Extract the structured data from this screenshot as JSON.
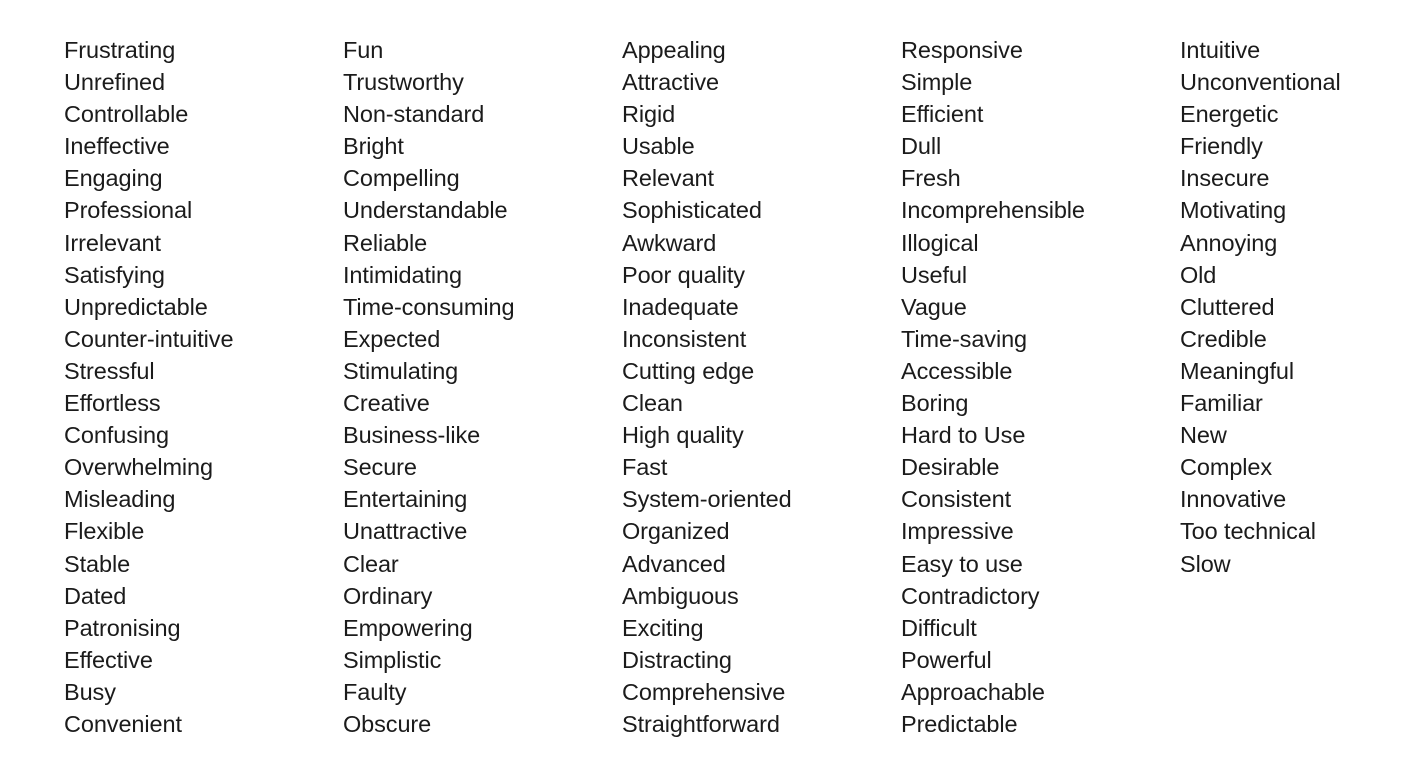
{
  "page": {
    "background_color": "#ffffff",
    "text_color": "#1b1b1b"
  },
  "columns": [
    {
      "id": "column-1",
      "words": [
        "Frustrating",
        "Unrefined",
        "Controllable",
        "Ineffective",
        "Engaging",
        "Professional",
        "Irrelevant",
        "Satisfying",
        "Unpredictable",
        "Counter-intuitive",
        "Stressful",
        "Effortless",
        "Confusing",
        "Overwhelming",
        "Misleading",
        "Flexible",
        "Stable",
        "Dated",
        "Patronising",
        "Effective",
        "Busy",
        "Convenient"
      ]
    },
    {
      "id": "column-2",
      "words": [
        "Fun",
        "Trustworthy",
        "Non-standard",
        "Bright",
        "Compelling",
        "Understandable",
        "Reliable",
        "Intimidating",
        "Time-consuming",
        "Expected",
        "Stimulating",
        "Creative",
        "Business-like",
        "Secure",
        "Entertaining",
        "Unattractive",
        "Clear",
        "Ordinary",
        "Empowering",
        "Simplistic",
        "Faulty",
        "Obscure"
      ]
    },
    {
      "id": "column-3",
      "words": [
        "Appealing",
        "Attractive",
        "Rigid",
        "Usable",
        "Relevant",
        "Sophisticated",
        "Awkward",
        "Poor quality",
        "Inadequate",
        "Inconsistent",
        "Cutting edge",
        "Clean",
        "High quality",
        "Fast",
        "System-oriented",
        "Organized",
        "Advanced",
        "Ambiguous",
        "Exciting",
        "Distracting",
        "Comprehensive",
        "Straightforward"
      ]
    },
    {
      "id": "column-4",
      "words": [
        "Responsive",
        "Simple",
        "Efficient",
        "Dull",
        "Fresh",
        "Incomprehensible",
        "Illogical",
        "Useful",
        "Vague",
        "Time-saving",
        "Accessible",
        "Boring",
        "Hard to Use",
        "Desirable",
        "Consistent",
        "Impressive",
        "Easy to use",
        "Contradictory",
        "Difficult",
        "Powerful",
        "Approachable",
        "Predictable"
      ]
    },
    {
      "id": "column-5",
      "words": [
        "Intuitive",
        "Unconventional",
        "Energetic",
        "Friendly",
        "Insecure",
        "Motivating",
        "Annoying",
        "Old",
        "Cluttered",
        "Credible",
        "Meaningful",
        "Familiar",
        "New",
        "Complex",
        "Innovative",
        "Too technical",
        "Slow"
      ]
    }
  ]
}
